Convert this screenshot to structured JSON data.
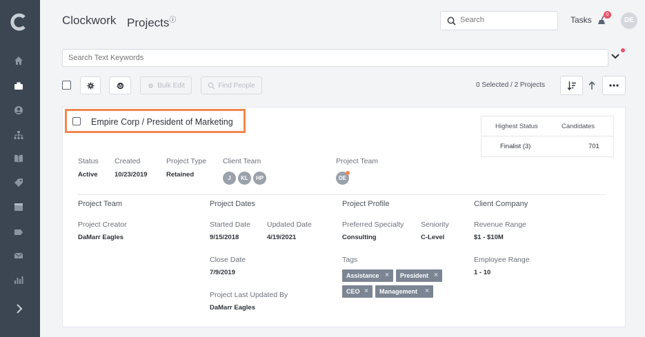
{
  "app": {
    "brand": "Clockwork",
    "page_title": "Projects",
    "info_glyph": "ⓘ"
  },
  "colors": {
    "sidebar_bg": "#3b4652",
    "accent_orange": "#f0874e",
    "badge_red": "#e8526b",
    "tag_bg": "#7b8593"
  },
  "sidebar": {
    "logo": "C",
    "items": [
      {
        "icon": "home-icon"
      },
      {
        "icon": "briefcase-icon",
        "active": true
      },
      {
        "icon": "user-circle-icon"
      },
      {
        "icon": "org-chart-icon"
      },
      {
        "icon": "book-icon"
      },
      {
        "icon": "tags-icon"
      },
      {
        "icon": "calendar-icon"
      },
      {
        "icon": "label-icon"
      },
      {
        "icon": "mail-icon"
      },
      {
        "icon": "bar-chart-icon"
      }
    ],
    "expand_icon": "chevron-right-icon"
  },
  "header": {
    "search_placeholder": "Search",
    "tasks_label": "Tasks",
    "tasks_badge": "0",
    "user_initials": "DE"
  },
  "keyword_search": {
    "placeholder": "Search Text Keywords"
  },
  "toolbar": {
    "bulk_edit_label": "Bulk Edit",
    "find_people_label": "Find People",
    "selection_summary": "0 Selected / 2 Projects"
  },
  "project": {
    "title": "Empire Corp / President of Marketing",
    "status_table": {
      "headers": [
        "Highest Status",
        "Candidates"
      ],
      "row": [
        "Finalist (3)",
        "701"
      ]
    },
    "summary": {
      "status_label": "Status",
      "status_value": "Active",
      "created_label": "Created",
      "created_value": "10/23/2019",
      "type_label": "Project Type",
      "type_value": "Retained",
      "client_team_label": "Client Team",
      "client_team": [
        "J",
        "KL",
        "HP"
      ],
      "project_team_label": "Project Team",
      "project_team": [
        "DE"
      ]
    },
    "sections": {
      "team": {
        "heading": "Project Team",
        "creator_label": "Project Creator",
        "creator_value": "DaMarr Eagles"
      },
      "dates": {
        "heading": "Project Dates",
        "started_label": "Started Date",
        "started_value": "9/15/2018",
        "updated_label": "Updated Date",
        "updated_value": "4/19/2021",
        "close_label": "Close Date",
        "close_value": "7/9/2019",
        "last_updated_by_label": "Project Last Updated By",
        "last_updated_by_value": "DaMarr Eagles"
      },
      "profile": {
        "heading": "Project Profile",
        "specialty_label": "Preferred Specialty",
        "specialty_value": "Consulting",
        "seniority_label": "Seniority",
        "seniority_value": "C-Level",
        "tags_label": "Tags",
        "tags": [
          "Assistance",
          "President",
          "CEO",
          "Management"
        ],
        "tag_remove_glyph": "×"
      },
      "client": {
        "heading": "Client Company",
        "revenue_label": "Revenue Range",
        "revenue_value": "$1 - $10M",
        "employee_label": "Employee Range",
        "employee_value": "1 - 10"
      }
    }
  }
}
